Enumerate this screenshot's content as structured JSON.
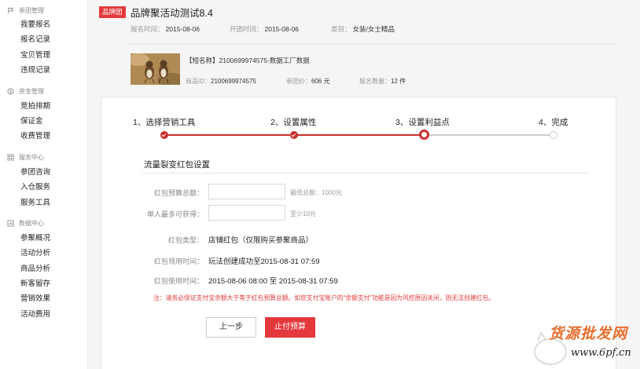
{
  "sidebar": {
    "groups": [
      {
        "title": "参团管理",
        "icon": "flag-icon",
        "items": [
          "我要报名",
          "报名记录",
          "宝贝管理",
          "违规记录"
        ]
      },
      {
        "title": "资金管理",
        "icon": "money-icon",
        "items": [
          "竞拍排期",
          "保证金",
          "收费管理"
        ]
      },
      {
        "title": "服务中心",
        "icon": "grid-icon",
        "items": [
          "参团咨询",
          "入仓服务",
          "服务工具"
        ]
      },
      {
        "title": "数据中心",
        "icon": "chart-icon",
        "items": [
          "参聚概况",
          "活动分析",
          "商品分析",
          "新客留存",
          "营销效果",
          "活动费用"
        ]
      }
    ]
  },
  "header": {
    "badge": "品牌团",
    "title": "品牌聚活动测试8.4",
    "signup_label": "报名时间：",
    "signup_value": "2015-08-06",
    "open_label": "开团时间：",
    "open_value": "2015-08-06",
    "category_label": "类目：",
    "category_value": "女装/女士精品"
  },
  "product": {
    "name": "【短名称】2100699974575-数据工厂数据",
    "id_label": "商品ID：",
    "id_value": "2100699974575",
    "price_label": "参团价：",
    "price_value": "606 元",
    "qty_label": "报名数量：",
    "qty_value": "12 件"
  },
  "steps": {
    "items": [
      "1、选择营销工具",
      "2、设置属性",
      "3、设置利益点",
      "4、完成"
    ],
    "statuses": [
      "done",
      "done",
      "current",
      "todo"
    ]
  },
  "form": {
    "section_title": "流量裂变红包设置",
    "budget_label": "红包预算总额：",
    "budget_value": "",
    "budget_hint": "最低总额：1000元",
    "max_label": "单人最多可获得：",
    "max_value": "",
    "max_hint": "至少10元",
    "type_label": "红包类型：",
    "type_value": "店铺红包（仅限购买参聚商品）",
    "claim_label": "红包领用时间：",
    "claim_value": "玩法创建成功至2015-08-31 07:59",
    "use_label": "红包使用时间：",
    "use_value": "2015-08-06 08:00 至 2015-08-31 07:59",
    "warning": "注：请务必保证支付宝余额大于等于红包预算总额。如您支付宝账户的“余额支付”功能是因为风控原因关闭，则无法创建红包。"
  },
  "buttons": {
    "prev": "上一步",
    "pay": "止付预算"
  },
  "watermark": {
    "line1": "货源批发网",
    "line2": "www.6pf.cn"
  },
  "colors": {
    "accent": "#e4393c",
    "step_done": "#c9302c",
    "step_todo": "#cccccc"
  }
}
